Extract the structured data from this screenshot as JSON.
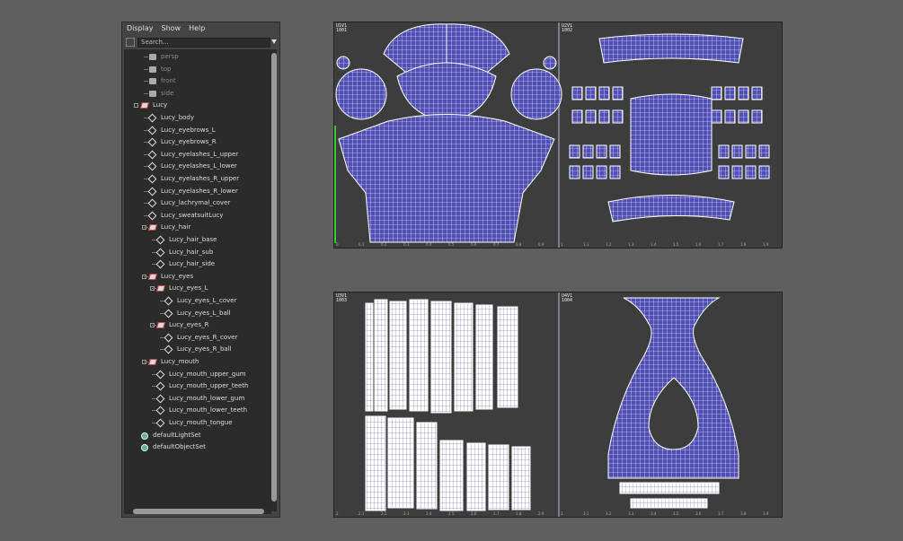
{
  "outliner": {
    "menu": [
      "Display",
      "Show",
      "Help"
    ],
    "search_placeholder": "Search...",
    "nodes": [
      {
        "label": "persp",
        "icon": "camera-icon",
        "level": 2,
        "dim": true
      },
      {
        "label": "top",
        "icon": "camera-icon",
        "level": 2,
        "dim": true
      },
      {
        "label": "front",
        "icon": "camera-icon",
        "level": 2,
        "dim": true
      },
      {
        "label": "side",
        "icon": "camera-icon",
        "level": 2,
        "dim": true
      },
      {
        "label": "Lucy",
        "icon": "group-icon",
        "level": 1,
        "expand": true
      },
      {
        "label": "Lucy_body",
        "icon": "mesh-icon",
        "level": 2
      },
      {
        "label": "Lucy_eyebrows_L",
        "icon": "mesh-icon",
        "level": 2
      },
      {
        "label": "Lucy_eyebrows_R",
        "icon": "mesh-icon",
        "level": 2
      },
      {
        "label": "Lucy_eyelashes_L_upper",
        "icon": "mesh-icon",
        "level": 2
      },
      {
        "label": "Lucy_eyelashes_L_lower",
        "icon": "mesh-icon",
        "level": 2
      },
      {
        "label": "Lucy_eyelashes_R_upper",
        "icon": "mesh-icon",
        "level": 2
      },
      {
        "label": "Lucy_eyelashes_R_lower",
        "icon": "mesh-icon",
        "level": 2
      },
      {
        "label": "Lucy_lachrymal_cover",
        "icon": "mesh-icon",
        "level": 2
      },
      {
        "label": "Lucy_sweatsuitLucy",
        "icon": "mesh-icon",
        "level": 2
      },
      {
        "label": "Lucy_hair",
        "icon": "group-icon",
        "level": 2,
        "expand": true
      },
      {
        "label": "Lucy_hair_base",
        "icon": "mesh-icon",
        "level": 3
      },
      {
        "label": "Lucy_hair_sub",
        "icon": "mesh-icon",
        "level": 3
      },
      {
        "label": "Lucy_hair_side",
        "icon": "mesh-icon",
        "level": 3
      },
      {
        "label": "Lucy_eyes",
        "icon": "group-icon",
        "level": 2,
        "expand": true
      },
      {
        "label": "Lucy_eyes_L",
        "icon": "group-icon",
        "level": 3,
        "expand": true
      },
      {
        "label": "Lucy_eyes_L_cover",
        "icon": "mesh-icon",
        "level": 4
      },
      {
        "label": "Lucy_eyes_L_ball",
        "icon": "mesh-icon",
        "level": 4
      },
      {
        "label": "Lucy_eyes_R",
        "icon": "group-icon",
        "level": 3,
        "expand": true
      },
      {
        "label": "Lucy_eyes_R_cover",
        "icon": "mesh-icon",
        "level": 4
      },
      {
        "label": "Lucy_eyes_R_ball",
        "icon": "mesh-icon",
        "level": 4
      },
      {
        "label": "Lucy_mouth",
        "icon": "group-icon",
        "level": 2,
        "expand": true
      },
      {
        "label": "Lucy_mouth_upper_gum",
        "icon": "mesh-icon",
        "level": 3
      },
      {
        "label": "Lucy_mouth_upper_teeth",
        "icon": "mesh-icon",
        "level": 3
      },
      {
        "label": "Lucy_mouth_lower_gum",
        "icon": "mesh-icon",
        "level": 3
      },
      {
        "label": "Lucy_mouth_lower_teeth",
        "icon": "mesh-icon",
        "level": 3
      },
      {
        "label": "Lucy_mouth_tongue",
        "icon": "mesh-icon",
        "level": 3
      },
      {
        "label": "defaultLightSet",
        "icon": "set-icon",
        "level": 1
      },
      {
        "label": "defaultObjectSet",
        "icon": "set-icon",
        "level": 1
      }
    ]
  },
  "uv_panels": [
    {
      "tiles": [
        {
          "tag_uv": "U1V1",
          "tag_num": "1001"
        },
        {
          "tag_uv": "U2V1",
          "tag_num": "1002"
        }
      ],
      "ticks": [
        "0",
        "0.1",
        "0.2",
        "0.3",
        "0.4",
        "0.5",
        "0.6",
        "0.7",
        "0.8",
        "0.9",
        "1",
        "1.1",
        "1.2",
        "1.3",
        "1.4",
        "1.5",
        "1.6",
        "1.7",
        "1.8",
        "1.9"
      ]
    },
    {
      "tiles": [
        {
          "tag_uv": "U3V1",
          "tag_num": "1003"
        },
        {
          "tag_uv": "U4V1",
          "tag_num": "1004"
        }
      ],
      "ticks": [
        "2",
        "2.1",
        "2.2",
        "2.3",
        "2.4",
        "2.5",
        "2.6",
        "2.7",
        "2.8",
        "2.9",
        "3",
        "3.1",
        "3.2",
        "3.3",
        "3.4",
        "3.5",
        "3.6",
        "3.7",
        "3.8",
        "3.9"
      ]
    }
  ],
  "colors": {
    "uv_fill": "#5050b4",
    "uv_wire": "#ffffff",
    "panel_bg": "#3d3d3d"
  }
}
